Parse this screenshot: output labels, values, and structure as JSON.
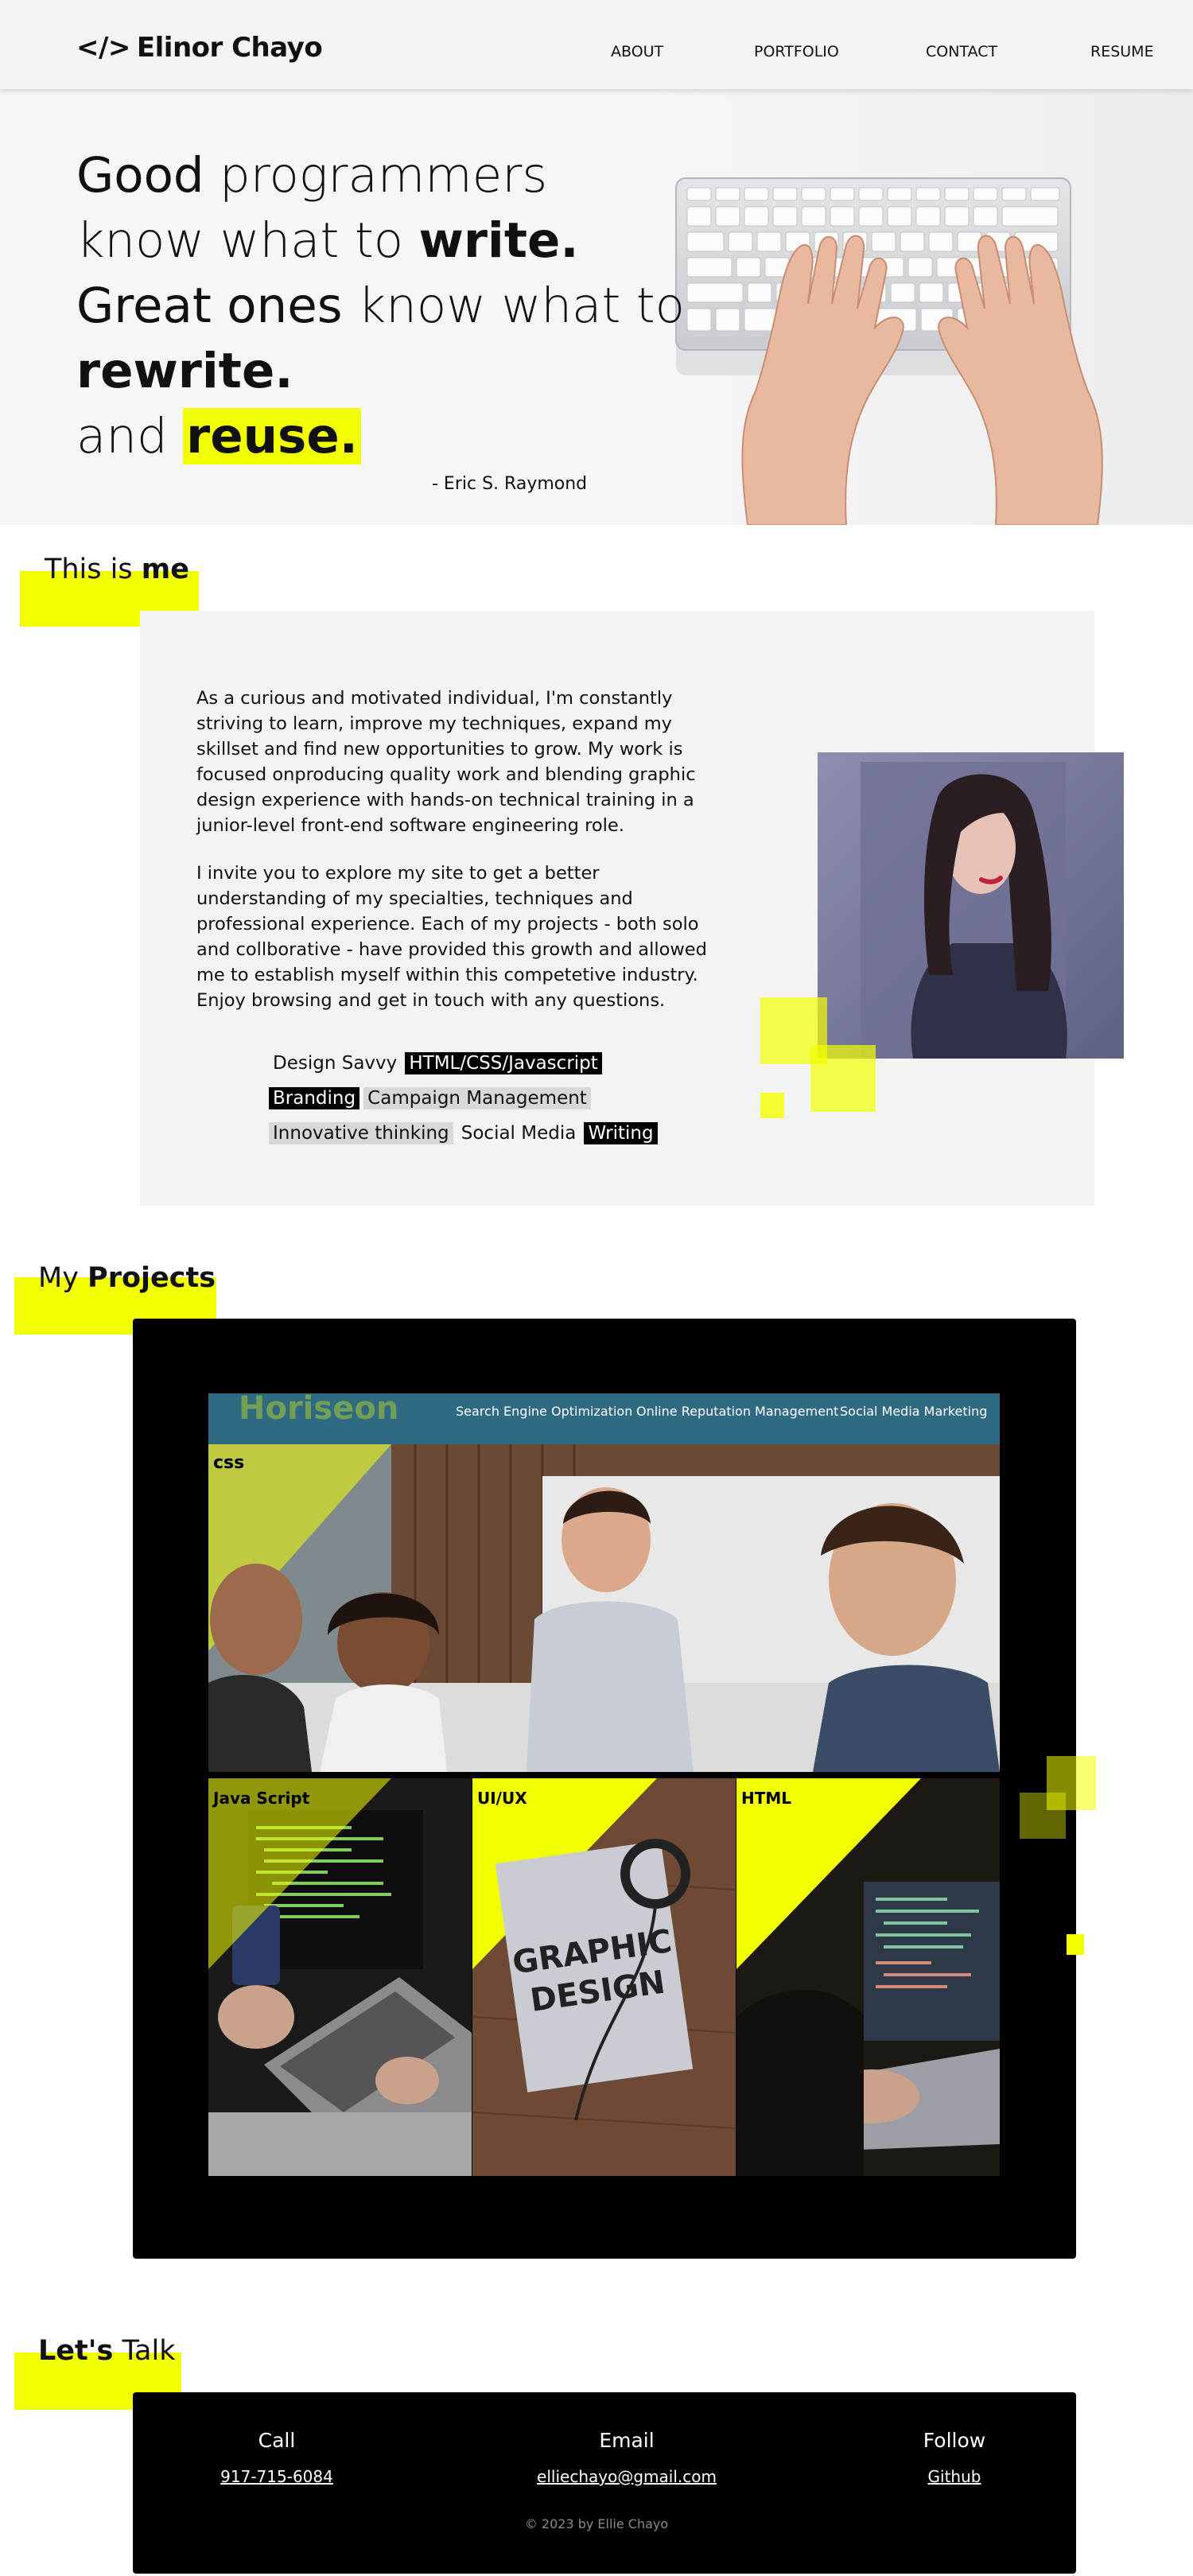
{
  "nav": {
    "brand_glyph": "</>",
    "brand": "Elinor Chayo",
    "links": [
      "ABOUT",
      "PORTFOLIO",
      "CONTACT",
      "RESUME"
    ]
  },
  "hero": {
    "l1_a": "Good",
    "l1_b": " programmers",
    "l2_a": "know what to ",
    "l2_b": "write.",
    "l3_a": "Great ones",
    "l3_b": " know what to",
    "l4": "rewrite.",
    "l5_a": "and ",
    "l5_b": "reuse.",
    "author": "- Eric S. Raymond",
    "image_icon": "keyboard-hands-photo"
  },
  "about": {
    "heading_a": "This is ",
    "heading_b": "me",
    "p1": "As a curious and motivated individual, I'm constantly striving to learn, improve my techniques, expand my skillset and find new opportunities to grow. My work is focused onproducing quality work and blending graphic design experience with hands-on technical training in a junior-level front-end software engineering role.",
    "p2": "I invite you to explore my site to get a better understanding of my specialties, techniques and professional experience. Each of my projects - both solo and collborative - have provided this growth and allowed me to establish myself within this competetive industry. Enjoy browsing and get in touch with any questions.",
    "skills": [
      {
        "label": "Design Savvy",
        "style": "plain"
      },
      {
        "label": "HTML/CSS/Javascript",
        "style": "dark"
      },
      {
        "label": "Branding",
        "style": "dark"
      },
      {
        "label": "Campaign Management",
        "style": "gray"
      },
      {
        "label": "Innovative thinking",
        "style": "gray"
      },
      {
        "label": "Social Media",
        "style": "plain"
      },
      {
        "label": "Writing",
        "style": "dark"
      }
    ],
    "portrait_icon": "portrait-photo"
  },
  "projects": {
    "heading_a": "My ",
    "heading_b": "Projects",
    "banner_brand": "Horiseon",
    "banner_nav": [
      "Search Engine Optimization",
      "Online Reputation Management",
      "Social Media Marketing"
    ],
    "main_label": "css",
    "tiles": [
      {
        "label": "Java Script",
        "icon": "coding-phone-laptop-photo"
      },
      {
        "label": "UI/UX",
        "icon": "graphic-design-book-photo"
      },
      {
        "label": "HTML",
        "icon": "laptop-code-photo"
      }
    ]
  },
  "contact": {
    "heading_a": "Let's",
    "heading_b": " Talk",
    "call_label": "Call",
    "call_value": "917-715-6084",
    "email_label": "Email",
    "email_value": "elliechayo@gmail.com",
    "follow_label": "Follow",
    "follow_value": "Github",
    "copyright": "© 2023 by Ellie Chayo"
  },
  "colors": {
    "accent": "#f2ff00",
    "banner": "#2f6a83",
    "card": "#f3f3f3",
    "dark": "#000000"
  }
}
